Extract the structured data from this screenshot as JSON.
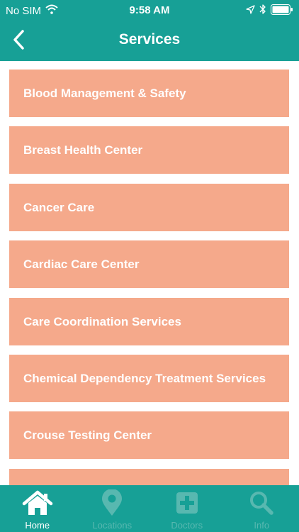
{
  "status_bar": {
    "carrier": "No SIM",
    "time": "9:58 AM"
  },
  "nav": {
    "title": "Services"
  },
  "services": [
    {
      "label": "Blood Management & Safety"
    },
    {
      "label": "Breast Health Center"
    },
    {
      "label": "Cancer Care"
    },
    {
      "label": "Cardiac Care Center"
    },
    {
      "label": "Care Coordination Services"
    },
    {
      "label": "Chemical Dependency Treatment Services"
    },
    {
      "label": "Crouse Testing Center"
    },
    {
      "label": ""
    }
  ],
  "tabs": [
    {
      "label": "Home",
      "icon": "home-icon",
      "active": true
    },
    {
      "label": "Locations",
      "icon": "location-pin-icon",
      "active": false
    },
    {
      "label": "Doctors",
      "icon": "medical-cross-icon",
      "active": false
    },
    {
      "label": "Info",
      "icon": "search-icon",
      "active": false
    }
  ],
  "colors": {
    "header": "#17a096",
    "list_item": "#f5a98b",
    "tab_active": "#ffffff",
    "tab_inactive": "#58b8b0"
  }
}
